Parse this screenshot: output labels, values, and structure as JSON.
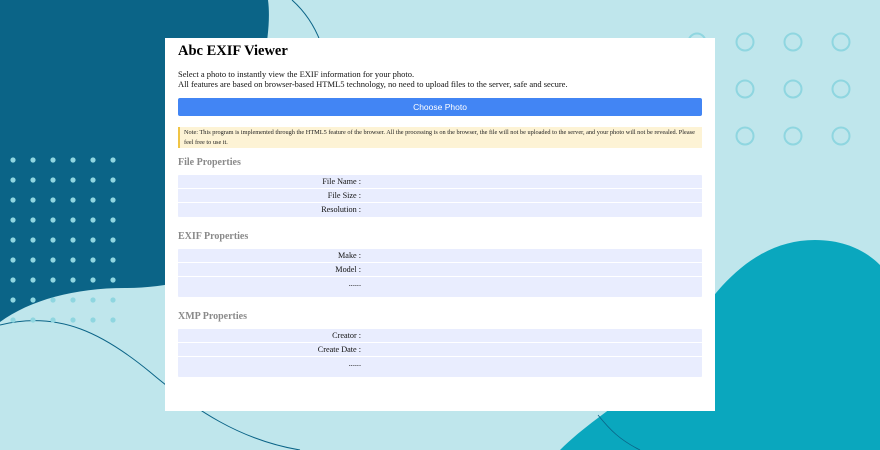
{
  "app": {
    "title": "Abc EXIF Viewer",
    "description_line1": "Select a photo to instantly view the EXIF information for your photo.",
    "description_line2": "All features are based on browser-based HTML5 technology, no need to upload files to the server, safe and secure.",
    "choose_button_label": "Choose Photo",
    "note": "Note: This program is implemented through the HTML5 feature of the browser. All the processing is on the browser, the file will not be uploaded to the server, and your photo will not be revealed. Please feel free to use it."
  },
  "sections": {
    "file": {
      "title": "File Properties",
      "rows": [
        {
          "label": "File Name :",
          "value": ""
        },
        {
          "label": "File Size :",
          "value": ""
        },
        {
          "label": "Resolution :",
          "value": ""
        }
      ]
    },
    "exif": {
      "title": "EXIF Properties",
      "rows": [
        {
          "label": "Make :",
          "value": ""
        },
        {
          "label": "Model :",
          "value": ""
        },
        {
          "label": "......",
          "value": ""
        }
      ]
    },
    "xmp": {
      "title": "XMP Properties",
      "rows": [
        {
          "label": "Creator :",
          "value": ""
        },
        {
          "label": "Create Date :",
          "value": ""
        },
        {
          "label": "......",
          "value": ""
        }
      ]
    }
  },
  "colors": {
    "background": "#bfe6ec",
    "dark_blob": "#0b6487",
    "teal_blob": "#0aa7be",
    "button": "#4285f4",
    "note_bg": "#fdf3d5",
    "note_border": "#f0c445",
    "row_bg": "#e9edfe"
  }
}
